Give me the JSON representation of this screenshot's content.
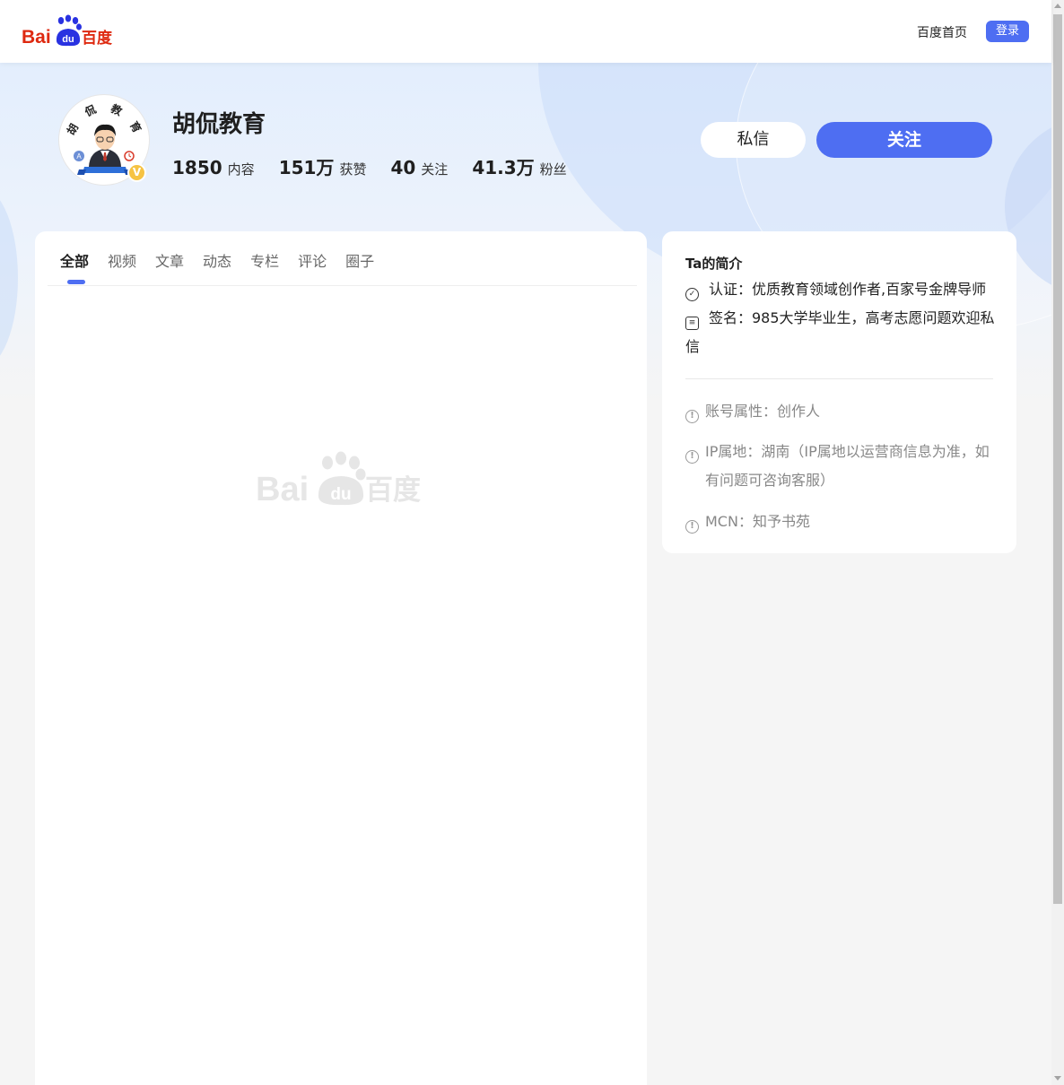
{
  "header": {
    "logo": "baidu-logo",
    "logo_text_left": "Bai",
    "logo_text_paw": "du",
    "logo_text_right": "百度",
    "home_link": "百度首页",
    "login_label": "登录"
  },
  "profile": {
    "name": "胡侃教育",
    "avatar_text": [
      "胡",
      "侃",
      "教",
      "育"
    ],
    "verified_badge": "V",
    "stats": [
      {
        "value": "1850",
        "label": "内容"
      },
      {
        "value": "151万",
        "label": "获赞"
      },
      {
        "value": "40",
        "label": "关注"
      },
      {
        "value": "41.3万",
        "label": "粉丝"
      }
    ],
    "message_label": "私信",
    "follow_label": "关注"
  },
  "tabs": [
    {
      "label": "全部",
      "active": true
    },
    {
      "label": "视频",
      "active": false
    },
    {
      "label": "文章",
      "active": false
    },
    {
      "label": "动态",
      "active": false
    },
    {
      "label": "专栏",
      "active": false
    },
    {
      "label": "评论",
      "active": false
    },
    {
      "label": "圈子",
      "active": false
    }
  ],
  "intro": {
    "title": "Ta的简介",
    "certification": "认证：优质教育领域创作者,百家号金牌导师",
    "signature": "签名：985大学毕业生，高考志愿问题欢迎私信",
    "account_type": "账号属性：创作人",
    "ip_location": "IP属地：湖南（IP属地以运营商信息为准，如有问题可咨询客服）",
    "mcn": "MCN：知予书苑"
  },
  "colors": {
    "accent": "#4e6ef2",
    "badge": "#f6c343"
  },
  "icons": {
    "certification": "verified-check-icon",
    "signature": "note-icon",
    "info": "exclamation-circle-icon"
  }
}
